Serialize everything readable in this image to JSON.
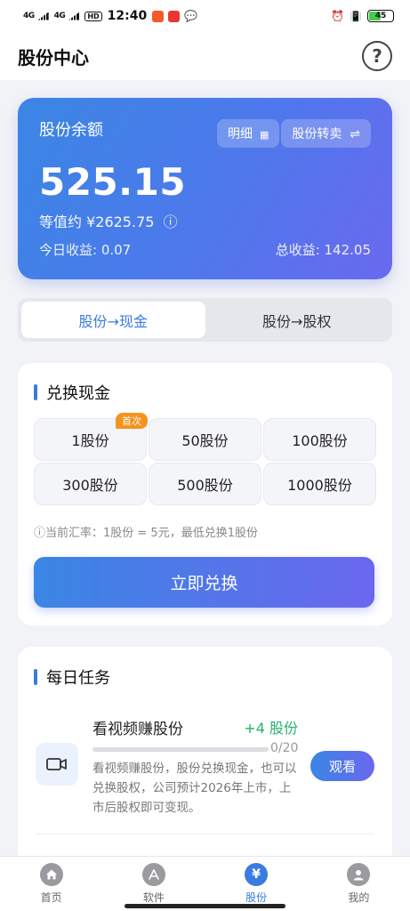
{
  "status_bar": {
    "net1": "4G",
    "net2": "4G",
    "hd": "HD",
    "time": "12:40",
    "battery": "45",
    "battery_level": 0.45,
    "app_icon_colors": [
      "#f25a2a",
      "#e8382e"
    ]
  },
  "header": {
    "title": "股份中心",
    "help_icon": "question-circle-icon"
  },
  "balance": {
    "label": "股份余额",
    "detail_btn": "明细",
    "transfer_btn": "股份转卖",
    "amount": "525.15",
    "equiv": "等值约 ¥2625.75",
    "today": "今日收益: 0.07",
    "total": "总收益: 142.05"
  },
  "tabs": [
    {
      "label": "股份→现金",
      "active": true
    },
    {
      "label": "股份→股权",
      "active": false
    }
  ],
  "exchange": {
    "title": "兑换现金",
    "options": [
      {
        "label": "1股份",
        "badge": "首次"
      },
      {
        "label": "50股份"
      },
      {
        "label": "100股份"
      },
      {
        "label": "300股份"
      },
      {
        "label": "500股份"
      },
      {
        "label": "1000股份"
      }
    ],
    "rate": "ⓘ当前汇率：1股份 = 5元，最低兑换1股份",
    "button": "立即兑换"
  },
  "daily": {
    "title": "每日任务",
    "task": {
      "title": "看视频赚股份",
      "reward": "+4 股份",
      "progress_text": "0/20",
      "progress": 0,
      "desc": "看视频赚股份，股份兑换现金，也可以兑换股权，公司预计2026年上市，上市后股权即可变现。",
      "button": "观看"
    }
  },
  "nav": [
    {
      "label": "首页",
      "icon": "home-icon",
      "active": false
    },
    {
      "label": "软件",
      "icon": "app-store-icon",
      "active": false
    },
    {
      "label": "股份",
      "icon": "yen-icon",
      "active": true
    },
    {
      "label": "我的",
      "icon": "user-icon",
      "active": false
    }
  ],
  "colors": {
    "accent": "#3a7be0",
    "gradient_start": "#3a86e4",
    "gradient_end": "#6a67ee",
    "reward_green": "#24b36b",
    "badge_orange": "#f5931f"
  }
}
